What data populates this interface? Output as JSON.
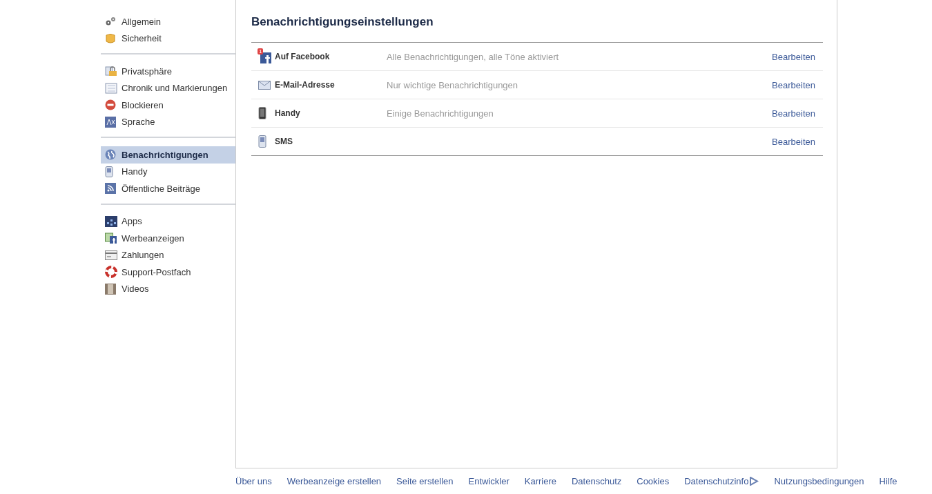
{
  "sidebar": {
    "groups": [
      {
        "items": [
          {
            "label": "Allgemein",
            "selected": false
          },
          {
            "label": "Sicherheit",
            "selected": false
          }
        ]
      },
      {
        "items": [
          {
            "label": "Privatsphäre",
            "selected": false
          },
          {
            "label": "Chronik und Markierungen",
            "selected": false
          },
          {
            "label": "Blockieren",
            "selected": false
          },
          {
            "label": "Sprache",
            "selected": false
          }
        ]
      },
      {
        "items": [
          {
            "label": "Benachrichtigungen",
            "selected": true
          },
          {
            "label": "Handy",
            "selected": false
          },
          {
            "label": "Öffentliche Beiträge",
            "selected": false
          }
        ]
      },
      {
        "items": [
          {
            "label": "Apps",
            "selected": false
          },
          {
            "label": "Werbeanzeigen",
            "selected": false
          },
          {
            "label": "Zahlungen",
            "selected": false
          },
          {
            "label": "Support-Postfach",
            "selected": false
          },
          {
            "label": "Videos",
            "selected": false
          }
        ]
      }
    ]
  },
  "main": {
    "title": "Benachrichtigungseinstellungen",
    "rows": [
      {
        "name": "Auf Facebook",
        "badge": "1",
        "summary": "Alle Benachrichtigungen, alle Töne aktiviert",
        "action": "Bearbeiten"
      },
      {
        "name": "E-Mail-Adresse",
        "summary": "Nur wichtige Benachrichtigungen",
        "action": "Bearbeiten"
      },
      {
        "name": "Handy",
        "summary": "Einige Benachrichtigungen",
        "action": "Bearbeiten"
      },
      {
        "name": "SMS",
        "action": "Bearbeiten"
      }
    ]
  },
  "footer": {
    "links": [
      "Über uns",
      "Werbeanzeige erstellen",
      "Seite erstellen",
      "Entwickler",
      "Karriere",
      "Datenschutz",
      "Cookies",
      "Datenschutzinfo",
      "Nutzungsbedingungen",
      "Hilfe"
    ]
  }
}
